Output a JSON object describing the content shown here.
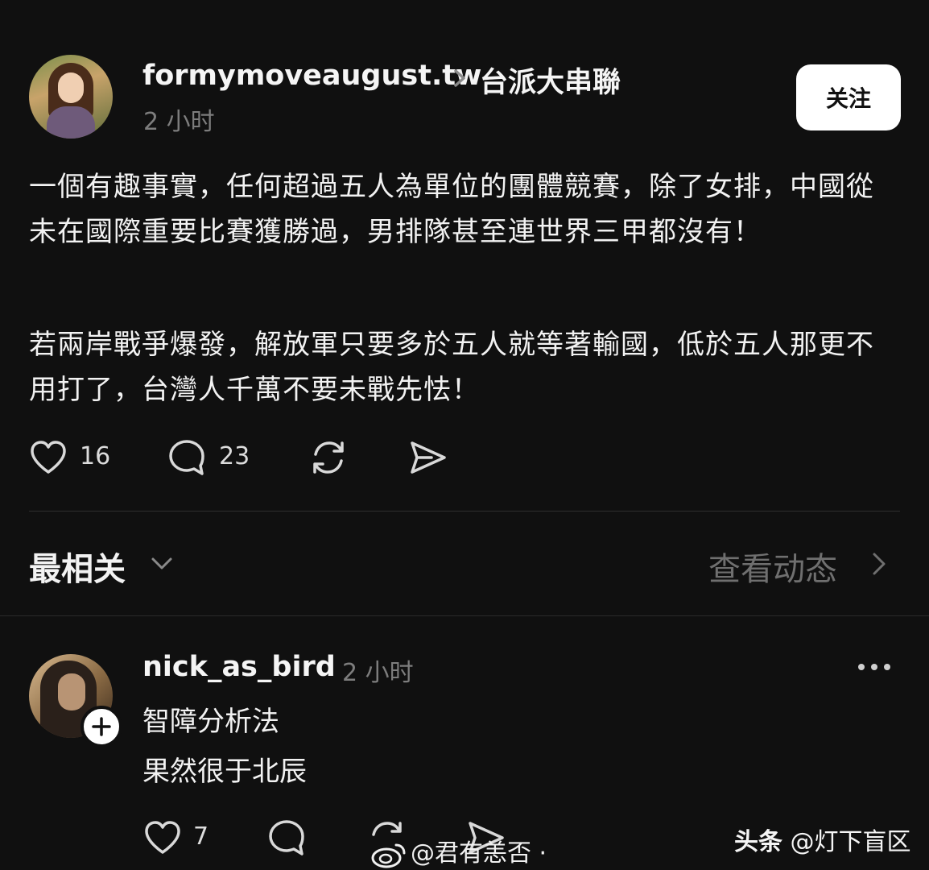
{
  "post": {
    "author": "formymoveaugust.tw",
    "group": "台派大串聯",
    "time": "2 小时",
    "follow_label": "关注",
    "paragraphs": [
      "一個有趣事實，任何超過五人為單位的團體競賽，除了女排，中國從未在國際重要比賽獲勝過，男排隊甚至連世界三甲都沒有！",
      "若兩岸戰爭爆發，解放軍只要多於五人就等著輸國，低於五人那更不用打了，台灣人千萬不要未戰先怯！"
    ],
    "like_count": "16",
    "comment_count": "23"
  },
  "sort": {
    "label": "最相关",
    "view_activity": "查看动态"
  },
  "reply": {
    "username": "nick_as_bird",
    "time": "2 小时",
    "lines": [
      "智障分析法",
      "果然很于北辰"
    ],
    "like_count": "7"
  },
  "watermarks": {
    "weibo": "@君有恙否 ·",
    "toutiao_brand": "头条",
    "toutiao_handle": " @灯下盲区"
  },
  "icons": {
    "like": "heart-icon",
    "comment": "comment-bubble-icon",
    "repost": "repost-icon",
    "share": "send-icon",
    "more": "more-horizontal-icon",
    "chevron": "chevron-icon",
    "add": "plus-icon"
  },
  "colors": {
    "background": "#101010",
    "primary_text": "#f2f2f2",
    "secondary_text": "#7d7d7d",
    "button_bg": "#ffffff"
  }
}
